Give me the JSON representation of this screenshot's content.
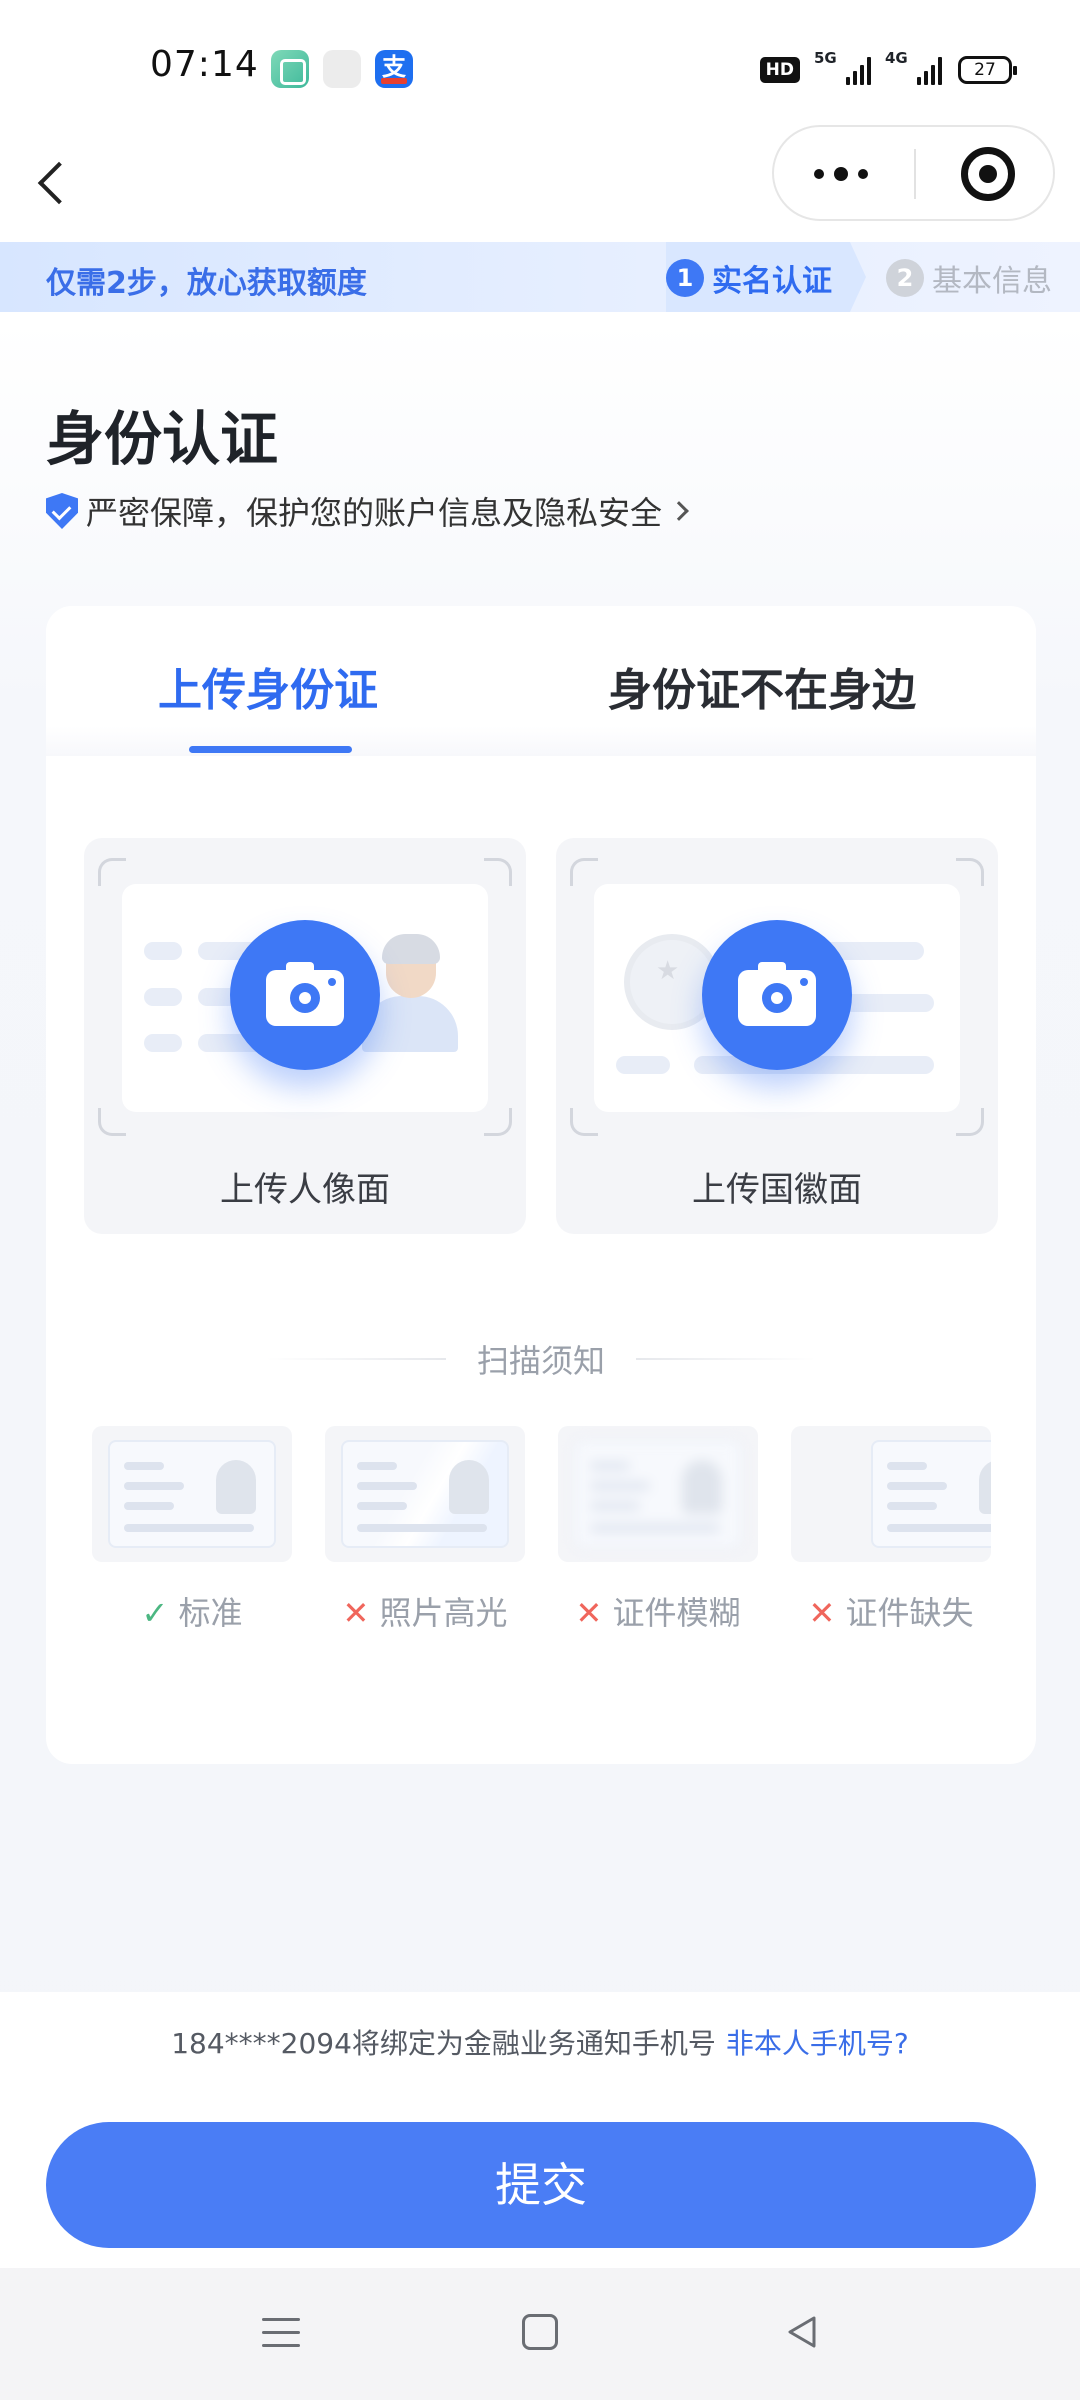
{
  "status_bar": {
    "time": "07:14",
    "app_icons": [
      "app-green-icon",
      "app-blank-icon",
      "alipay-icon"
    ],
    "alipay_glyph": "支",
    "hd_label": "HD",
    "sig1_label": "5G",
    "sig2_label": "4G",
    "battery": "27"
  },
  "nav": {
    "back_icon": "back-arrow-icon",
    "more_icon": "more-dots-icon",
    "close_icon": "target-circle-icon"
  },
  "banner": {
    "text": "仅需2步，放心获取额度",
    "steps": [
      {
        "num": "1",
        "label": "实名认证",
        "active": true
      },
      {
        "num": "2",
        "label": "基本信息",
        "active": false
      }
    ]
  },
  "header": {
    "title": "身份认证",
    "secure_text": "严密保障，保护您的账户信息及隐私安全"
  },
  "tabs": [
    {
      "label": "上传身份证",
      "active": true
    },
    {
      "label": "身份证不在身边",
      "active": false
    }
  ],
  "uploads": [
    {
      "label": "上传人像面"
    },
    {
      "label": "上传国徽面"
    }
  ],
  "scan": {
    "title": "扫描须知",
    "samples": [
      {
        "mark": "✓",
        "label": "标准",
        "status": "ok"
      },
      {
        "mark": "✕",
        "label": "照片高光",
        "status": "bad"
      },
      {
        "mark": "✕",
        "label": "证件模糊",
        "status": "bad"
      },
      {
        "mark": "✕",
        "label": "证件缺失",
        "status": "bad"
      }
    ]
  },
  "footer": {
    "phone_note": "184****2094将绑定为金融业务通知手机号",
    "phone_link": "非本人手机号?",
    "submit": "提交"
  },
  "colors": {
    "accent": "#3e78f5",
    "submit": "#4a7df5",
    "ok": "#4cb782",
    "bad": "#f0665c"
  }
}
